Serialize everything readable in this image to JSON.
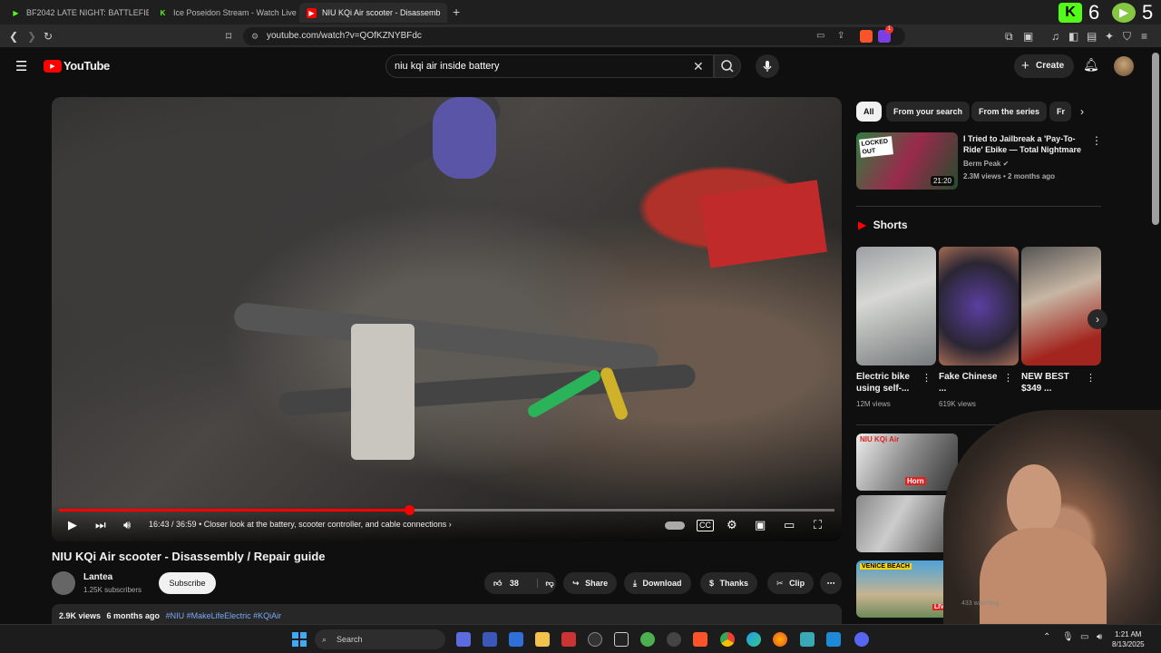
{
  "browser": {
    "tabs": [
      {
        "title": "BF2042 LATE NIGHT: BATTLEFIELD",
        "fav_color": "#53fc18"
      },
      {
        "title": "Ice Poseidon Stream - Watch Live on",
        "fav_color": "#53fc18"
      },
      {
        "title": "NIU KQi Air scooter - Disassemb",
        "fav_color": "#ff0000"
      }
    ],
    "new_tab": "+",
    "url": "youtube.com/watch?v=QOfKZNYBFdc",
    "kick_count": "6",
    "rumble_count": "5",
    "brave_badge": "1"
  },
  "youtube": {
    "logo": "YouTube",
    "search_value": "niu kqi air inside battery",
    "create_label": "Create"
  },
  "player": {
    "time": "16:43 / 36:59",
    "chapter": "Closer look at the battery, scooter controller, and cable connections",
    "progress": 0.4518
  },
  "video": {
    "title": "NIU KQi Air scooter - Disassembly / Repair guide",
    "channel": "Lantea",
    "subscribers": "1.25K subscribers",
    "subscribe_label": "Subscribe",
    "likes": "38",
    "share_label": "Share",
    "download_label": "Download",
    "thanks_label": "Thanks",
    "clip_label": "Clip",
    "views": "2.9K views",
    "age": "6 months ago",
    "tags": "#NIU #MakeLifeElectric #KQiAir"
  },
  "sidebar": {
    "chips": [
      "All",
      "From your search",
      "From the series",
      "Fr"
    ],
    "recommended": {
      "title": "I Tried to Jailbreak a 'Pay-To-Ride' Ebike — Total Nightmare",
      "channel": "Berm Peak",
      "meta": "2.3M views • 2 months ago",
      "duration": "21:20",
      "thumb_text": "LOCKED OUT"
    },
    "shorts_heading": "Shorts",
    "shorts": [
      {
        "title": "Electric bike using self-...",
        "views": "12M views"
      },
      {
        "title": "Fake Chinese ...",
        "views": "619K views"
      },
      {
        "title": "NEW BEST $349 ...",
        "views": ""
      }
    ],
    "more_thumbs": [
      {
        "text": "NIU KQi Air",
        "badge": "Horn"
      },
      {
        "text": "",
        "badge": ""
      },
      {
        "text": "VENICE BEACH",
        "badge": "LIVE"
      }
    ],
    "partial_meta": "433 watching"
  },
  "taskbar": {
    "search_label": "Search",
    "time": "1:21 AM",
    "date": "8/13/2025"
  }
}
